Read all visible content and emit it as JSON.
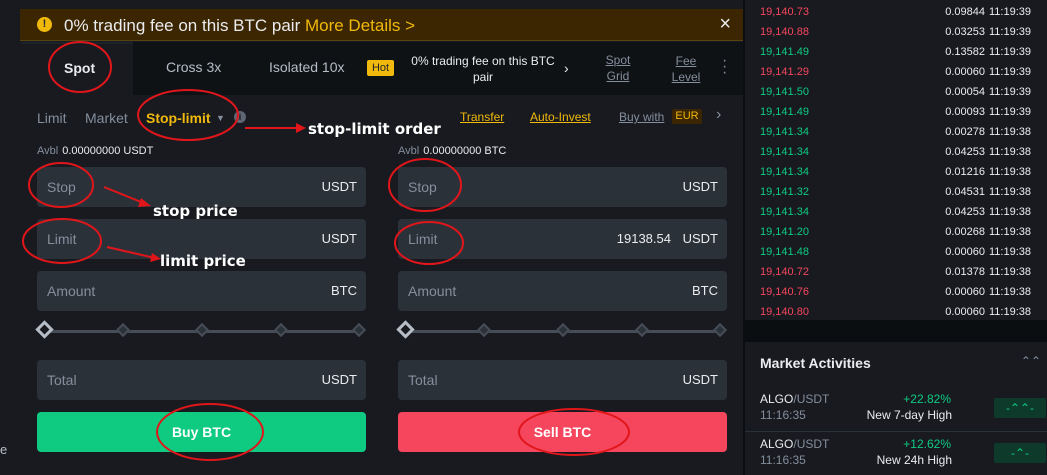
{
  "banner": {
    "text": "0% trading fee on this BTC pair",
    "link": "More Details >",
    "close": "×"
  },
  "tabs": {
    "spot": "Spot",
    "cross": "Cross 3x",
    "isolated": "Isolated 10x",
    "hot_badge": "Hot",
    "promo_line1": "0% trading fee on this BTC",
    "promo_line2": "pair",
    "promo_arrow": "›",
    "spot_grid_line1": "Spot",
    "spot_grid_line2": "Grid",
    "fee_level_line1": "Fee",
    "fee_level_line2": "Level"
  },
  "order_types": {
    "limit": "Limit",
    "market": "Market",
    "stop_limit": "Stop-limit",
    "info": "i",
    "transfer": "Transfer",
    "auto_invest": "Auto-Invest",
    "buy_with": "Buy with",
    "currency": "EUR",
    "chevron": "›"
  },
  "buy": {
    "avbl_label": "Avbl",
    "avbl_value": "0.00000000 USDT",
    "stop": {
      "label": "Stop",
      "value": "",
      "unit": "USDT"
    },
    "limit": {
      "label": "Limit",
      "value": "",
      "unit": "USDT"
    },
    "amount": {
      "label": "Amount",
      "value": "",
      "unit": "BTC"
    },
    "total": {
      "label": "Total",
      "value": "",
      "unit": "USDT"
    },
    "button": "Buy BTC",
    "slider_level": 0
  },
  "sell": {
    "avbl_label": "Avbl",
    "avbl_value": "0.00000000 BTC",
    "stop": {
      "label": "Stop",
      "value": "",
      "unit": "USDT"
    },
    "limit": {
      "label": "Limit",
      "value": "19138.54",
      "unit": "USDT"
    },
    "amount": {
      "label": "Amount",
      "value": "",
      "unit": "BTC"
    },
    "total": {
      "label": "Total",
      "value": "",
      "unit": "USDT"
    },
    "button": "Sell BTC",
    "slider_level": 0
  },
  "annotations": {
    "stop_limit": "stop-limit order",
    "stop_price": "stop price",
    "limit_price": "limit price",
    "color": "#e0161b"
  },
  "left_edge": {
    "char": "e"
  },
  "trades": [
    {
      "price": "19,140.73",
      "dir": "down",
      "amount": "0.09844",
      "time": "11:19:39"
    },
    {
      "price": "19,140.88",
      "dir": "down",
      "amount": "0.03253",
      "time": "11:19:39"
    },
    {
      "price": "19,141.49",
      "dir": "up",
      "amount": "0.13582",
      "time": "11:19:39"
    },
    {
      "price": "19,141.29",
      "dir": "down",
      "amount": "0.00060",
      "time": "11:19:39"
    },
    {
      "price": "19,141.50",
      "dir": "up",
      "amount": "0.00054",
      "time": "11:19:39"
    },
    {
      "price": "19,141.49",
      "dir": "up",
      "amount": "0.00093",
      "time": "11:19:39"
    },
    {
      "price": "19,141.34",
      "dir": "up",
      "amount": "0.00278",
      "time": "11:19:38"
    },
    {
      "price": "19,141.34",
      "dir": "up",
      "amount": "0.04253",
      "time": "11:19:38"
    },
    {
      "price": "19,141.34",
      "dir": "up",
      "amount": "0.01216",
      "time": "11:19:38"
    },
    {
      "price": "19,141.32",
      "dir": "up",
      "amount": "0.04531",
      "time": "11:19:38"
    },
    {
      "price": "19,141.34",
      "dir": "up",
      "amount": "0.04253",
      "time": "11:19:38"
    },
    {
      "price": "19,141.20",
      "dir": "up",
      "amount": "0.00268",
      "time": "11:19:38"
    },
    {
      "price": "19,141.48",
      "dir": "up",
      "amount": "0.00060",
      "time": "11:19:38"
    },
    {
      "price": "19,140.72",
      "dir": "down",
      "amount": "0.01378",
      "time": "11:19:38"
    },
    {
      "price": "19,140.76",
      "dir": "down",
      "amount": "0.00060",
      "time": "11:19:38"
    },
    {
      "price": "19,140.80",
      "dir": "down",
      "amount": "0.00060",
      "time": "11:19:38"
    }
  ],
  "market_activities": {
    "title": "Market Activities",
    "toggle": "⌃⌃",
    "items": [
      {
        "base": "ALGO",
        "quote": "/USDT",
        "time": "11:16:35",
        "change": "+22.82%",
        "desc": "New 7-day High",
        "badge": "-⌃⌃-"
      },
      {
        "base": "ALGO",
        "quote": "/USDT",
        "time": "11:16:35",
        "change": "+12.62%",
        "desc": "New 24h High",
        "badge": "-⌃-"
      }
    ]
  },
  "colors": {
    "up": "#0ecb81",
    "down": "#f6465d",
    "accent": "#f0b90b"
  }
}
